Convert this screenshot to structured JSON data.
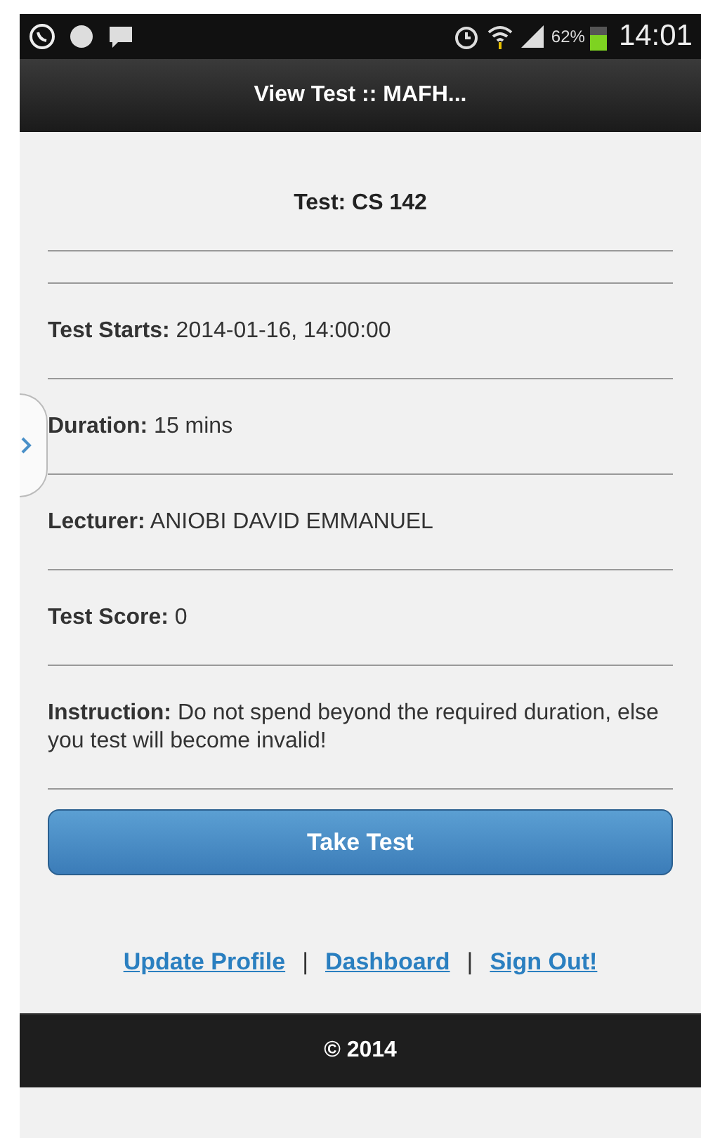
{
  "status_bar": {
    "battery": "62%",
    "time": "14:01"
  },
  "header": {
    "title": "View Test :: MAFH..."
  },
  "test_title": "Test: CS 142",
  "fields": [
    {
      "label": "Test Starts:",
      "value": "2014-01-16, 14:00:00"
    },
    {
      "label": "Duration:",
      "value": "15 mins"
    },
    {
      "label": "Lecturer:",
      "value": "ANIOBI DAVID EMMANUEL"
    },
    {
      "label": "Test Score:",
      "value": "0"
    },
    {
      "label": "Instruction:",
      "value": "Do not spend beyond the required duration, else you test will become invalid!"
    }
  ],
  "action_button": "Take Test",
  "links": [
    {
      "kind": "link",
      "text": "Update Profile"
    },
    {
      "kind": "separator",
      "text": "|"
    },
    {
      "kind": "link",
      "text": "Dashboard"
    },
    {
      "kind": "separator",
      "text": "|"
    },
    {
      "kind": "link",
      "text": "Sign Out!"
    }
  ],
  "footer": "© 2014"
}
